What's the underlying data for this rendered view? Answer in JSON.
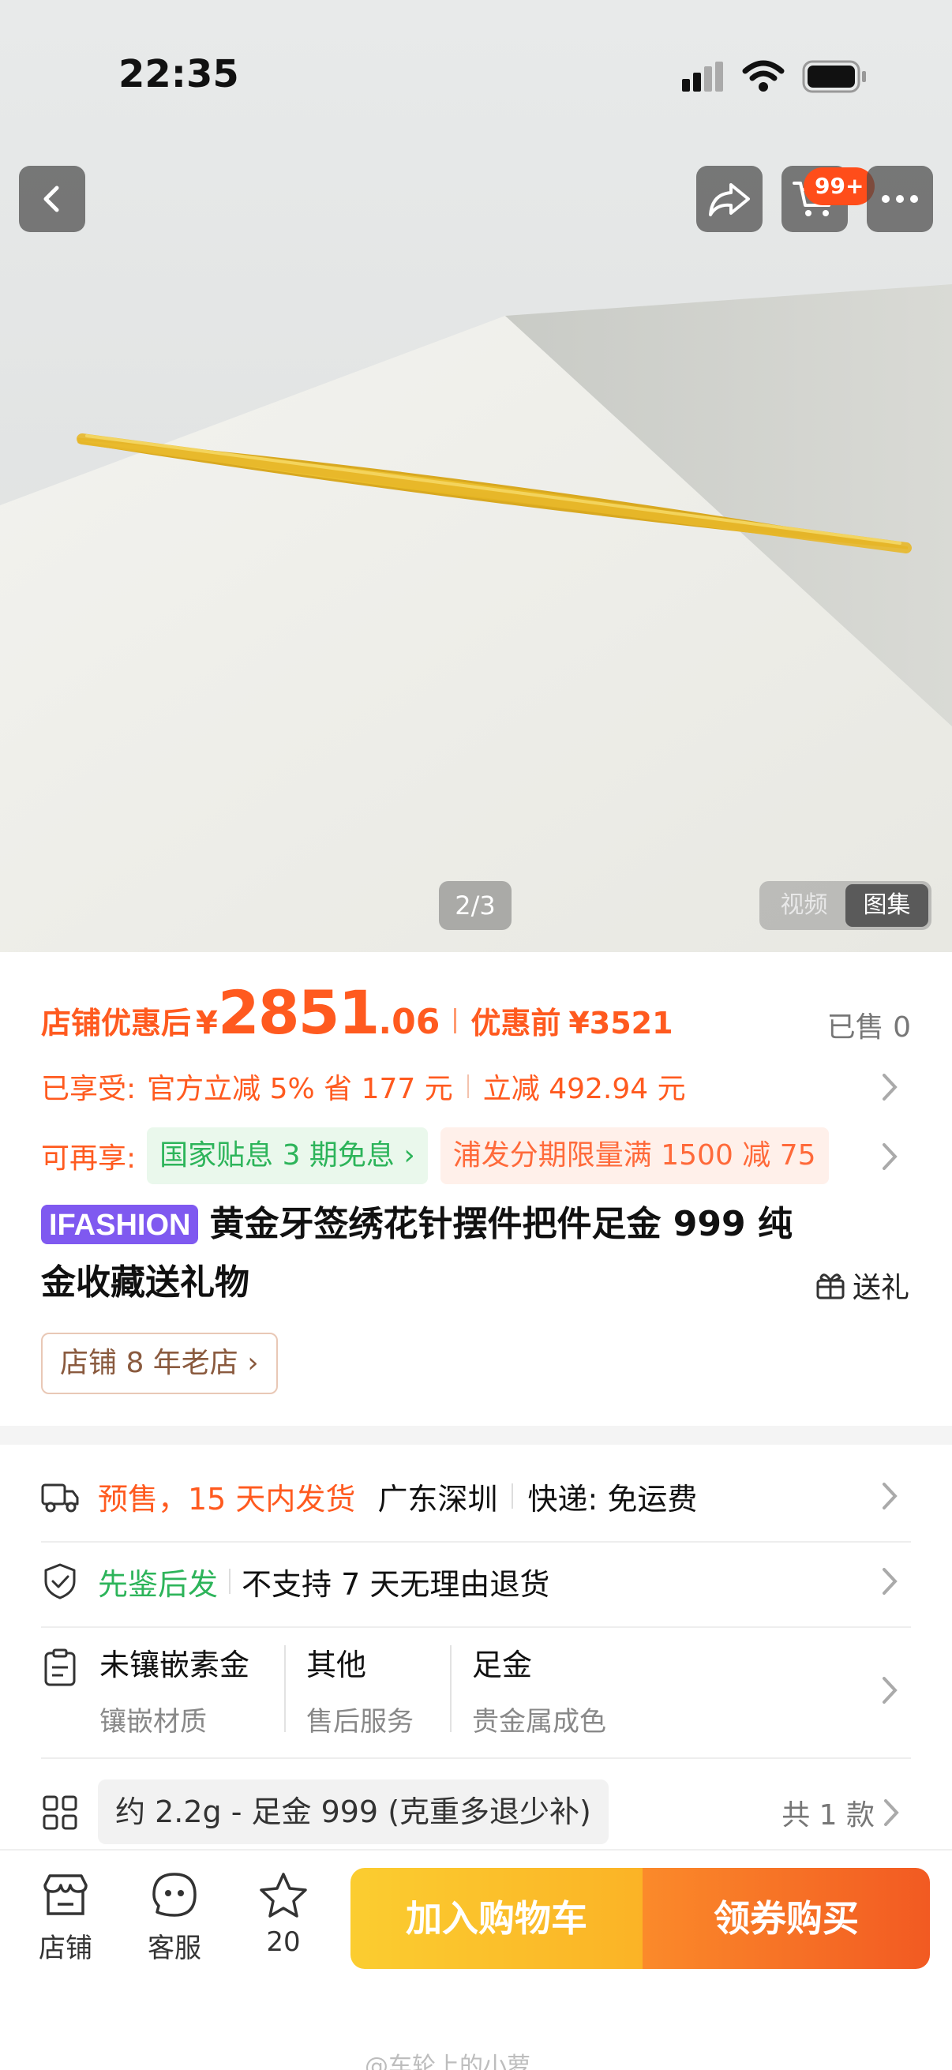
{
  "status_bar": {
    "time": "22:35"
  },
  "header": {
    "cart_badge": "99+"
  },
  "gallery": {
    "counter": "2/3",
    "tabs": [
      "视频",
      "图集"
    ],
    "active_tab": "图集"
  },
  "price": {
    "store_discount_label": "店铺优惠后",
    "currency": "¥",
    "price_integer": "2851",
    "price_decimal": ".06",
    "before_label": "优惠前",
    "before_price": "¥3521",
    "sold": "已售 0"
  },
  "promos": {
    "enjoyed_label": "已享受:",
    "enjoyed_1": "官方立减 5% 省 177 元",
    "enjoyed_2": "立减 492.94 元",
    "more_label": "可再享:",
    "tag_1": "国家贴息 3 期免息 ›",
    "tag_2": "浦发分期限量满 1500 减 75"
  },
  "product": {
    "brand": "IFASHION",
    "title_line1": "黄金牙签绣花针摆件把件足金 999 纯",
    "title_line2": "金收藏送礼物",
    "gift_label": "送礼",
    "store_tag": "店铺 8 年老店 ›"
  },
  "shipping": {
    "presale": "预售，15 天内发货",
    "location": "广东深圳",
    "express": "快递: 免运费"
  },
  "service": {
    "inspect": "先鉴后发",
    "return_policy": "不支持 7 天无理由退货"
  },
  "attributes": [
    {
      "value": "未镶嵌素金",
      "label": "镶嵌材质"
    },
    {
      "value": "其他",
      "label": "售后服务"
    },
    {
      "value": "足金",
      "label": "贵金属成色"
    }
  ],
  "sku": {
    "spec": "约 2.2g - 足金 999 (克重多退少补)",
    "count": "共 1 款"
  },
  "bottom_bar": {
    "store": "店铺",
    "service": "客服",
    "favorites": "20",
    "add_to_cart": "加入购物车",
    "buy": "领券购买"
  },
  "watermark": "@车轮上的小萝",
  "colors": {
    "accent": "#ff5a1f",
    "brand_purple": "#7f59f0",
    "green": "#2db45a"
  }
}
